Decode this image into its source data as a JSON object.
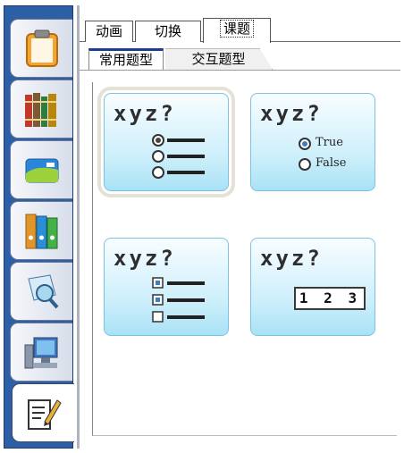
{
  "sidebar": {
    "buttons": [
      {
        "name": "clipboard-icon"
      },
      {
        "name": "books-icon"
      },
      {
        "name": "card-icon"
      },
      {
        "name": "binders-icon"
      },
      {
        "name": "search-analyze-icon"
      },
      {
        "name": "computer-icon"
      },
      {
        "name": "edit-document-icon"
      }
    ],
    "active_index": 6
  },
  "tabs": {
    "items": [
      "动画",
      "切换",
      "课题"
    ],
    "active": "课题"
  },
  "subtabs": {
    "items": [
      "常用题型",
      "交互题型"
    ],
    "active": "常用题型"
  },
  "cards": [
    {
      "title": "xyz?",
      "type": "single-choice"
    },
    {
      "title": "xyz?",
      "type": "true-false",
      "options": [
        "True",
        "False"
      ]
    },
    {
      "title": "xyz?",
      "type": "multiple-choice"
    },
    {
      "title": "xyz?",
      "type": "fill-number",
      "value": "1 2 3"
    }
  ],
  "colors": {
    "sidebar_bg": "#2d5fa6",
    "card_fill": "#cdeffb",
    "card_border": "#7dc2e0",
    "subtab_accent": "#1d3f8f"
  }
}
